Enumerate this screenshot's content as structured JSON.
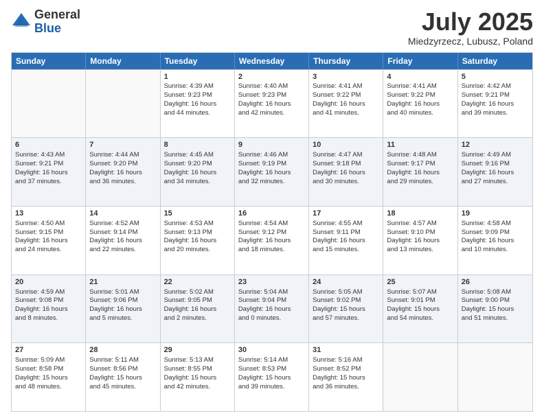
{
  "logo": {
    "general": "General",
    "blue": "Blue"
  },
  "title": "July 2025",
  "location": "Miedzyrzecz, Lubusz, Poland",
  "days": [
    "Sunday",
    "Monday",
    "Tuesday",
    "Wednesday",
    "Thursday",
    "Friday",
    "Saturday"
  ],
  "weeks": [
    [
      {
        "day": "",
        "info": ""
      },
      {
        "day": "",
        "info": ""
      },
      {
        "day": "1",
        "info": "Sunrise: 4:39 AM\nSunset: 9:23 PM\nDaylight: 16 hours\nand 44 minutes."
      },
      {
        "day": "2",
        "info": "Sunrise: 4:40 AM\nSunset: 9:23 PM\nDaylight: 16 hours\nand 42 minutes."
      },
      {
        "day": "3",
        "info": "Sunrise: 4:41 AM\nSunset: 9:22 PM\nDaylight: 16 hours\nand 41 minutes."
      },
      {
        "day": "4",
        "info": "Sunrise: 4:41 AM\nSunset: 9:22 PM\nDaylight: 16 hours\nand 40 minutes."
      },
      {
        "day": "5",
        "info": "Sunrise: 4:42 AM\nSunset: 9:21 PM\nDaylight: 16 hours\nand 39 minutes."
      }
    ],
    [
      {
        "day": "6",
        "info": "Sunrise: 4:43 AM\nSunset: 9:21 PM\nDaylight: 16 hours\nand 37 minutes."
      },
      {
        "day": "7",
        "info": "Sunrise: 4:44 AM\nSunset: 9:20 PM\nDaylight: 16 hours\nand 36 minutes."
      },
      {
        "day": "8",
        "info": "Sunrise: 4:45 AM\nSunset: 9:20 PM\nDaylight: 16 hours\nand 34 minutes."
      },
      {
        "day": "9",
        "info": "Sunrise: 4:46 AM\nSunset: 9:19 PM\nDaylight: 16 hours\nand 32 minutes."
      },
      {
        "day": "10",
        "info": "Sunrise: 4:47 AM\nSunset: 9:18 PM\nDaylight: 16 hours\nand 30 minutes."
      },
      {
        "day": "11",
        "info": "Sunrise: 4:48 AM\nSunset: 9:17 PM\nDaylight: 16 hours\nand 29 minutes."
      },
      {
        "day": "12",
        "info": "Sunrise: 4:49 AM\nSunset: 9:16 PM\nDaylight: 16 hours\nand 27 minutes."
      }
    ],
    [
      {
        "day": "13",
        "info": "Sunrise: 4:50 AM\nSunset: 9:15 PM\nDaylight: 16 hours\nand 24 minutes."
      },
      {
        "day": "14",
        "info": "Sunrise: 4:52 AM\nSunset: 9:14 PM\nDaylight: 16 hours\nand 22 minutes."
      },
      {
        "day": "15",
        "info": "Sunrise: 4:53 AM\nSunset: 9:13 PM\nDaylight: 16 hours\nand 20 minutes."
      },
      {
        "day": "16",
        "info": "Sunrise: 4:54 AM\nSunset: 9:12 PM\nDaylight: 16 hours\nand 18 minutes."
      },
      {
        "day": "17",
        "info": "Sunrise: 4:55 AM\nSunset: 9:11 PM\nDaylight: 16 hours\nand 15 minutes."
      },
      {
        "day": "18",
        "info": "Sunrise: 4:57 AM\nSunset: 9:10 PM\nDaylight: 16 hours\nand 13 minutes."
      },
      {
        "day": "19",
        "info": "Sunrise: 4:58 AM\nSunset: 9:09 PM\nDaylight: 16 hours\nand 10 minutes."
      }
    ],
    [
      {
        "day": "20",
        "info": "Sunrise: 4:59 AM\nSunset: 9:08 PM\nDaylight: 16 hours\nand 8 minutes."
      },
      {
        "day": "21",
        "info": "Sunrise: 5:01 AM\nSunset: 9:06 PM\nDaylight: 16 hours\nand 5 minutes."
      },
      {
        "day": "22",
        "info": "Sunrise: 5:02 AM\nSunset: 9:05 PM\nDaylight: 16 hours\nand 2 minutes."
      },
      {
        "day": "23",
        "info": "Sunrise: 5:04 AM\nSunset: 9:04 PM\nDaylight: 16 hours\nand 0 minutes."
      },
      {
        "day": "24",
        "info": "Sunrise: 5:05 AM\nSunset: 9:02 PM\nDaylight: 15 hours\nand 57 minutes."
      },
      {
        "day": "25",
        "info": "Sunrise: 5:07 AM\nSunset: 9:01 PM\nDaylight: 15 hours\nand 54 minutes."
      },
      {
        "day": "26",
        "info": "Sunrise: 5:08 AM\nSunset: 9:00 PM\nDaylight: 15 hours\nand 51 minutes."
      }
    ],
    [
      {
        "day": "27",
        "info": "Sunrise: 5:09 AM\nSunset: 8:58 PM\nDaylight: 15 hours\nand 48 minutes."
      },
      {
        "day": "28",
        "info": "Sunrise: 5:11 AM\nSunset: 8:56 PM\nDaylight: 15 hours\nand 45 minutes."
      },
      {
        "day": "29",
        "info": "Sunrise: 5:13 AM\nSunset: 8:55 PM\nDaylight: 15 hours\nand 42 minutes."
      },
      {
        "day": "30",
        "info": "Sunrise: 5:14 AM\nSunset: 8:53 PM\nDaylight: 15 hours\nand 39 minutes."
      },
      {
        "day": "31",
        "info": "Sunrise: 5:16 AM\nSunset: 8:52 PM\nDaylight: 15 hours\nand 36 minutes."
      },
      {
        "day": "",
        "info": ""
      },
      {
        "day": "",
        "info": ""
      }
    ]
  ]
}
